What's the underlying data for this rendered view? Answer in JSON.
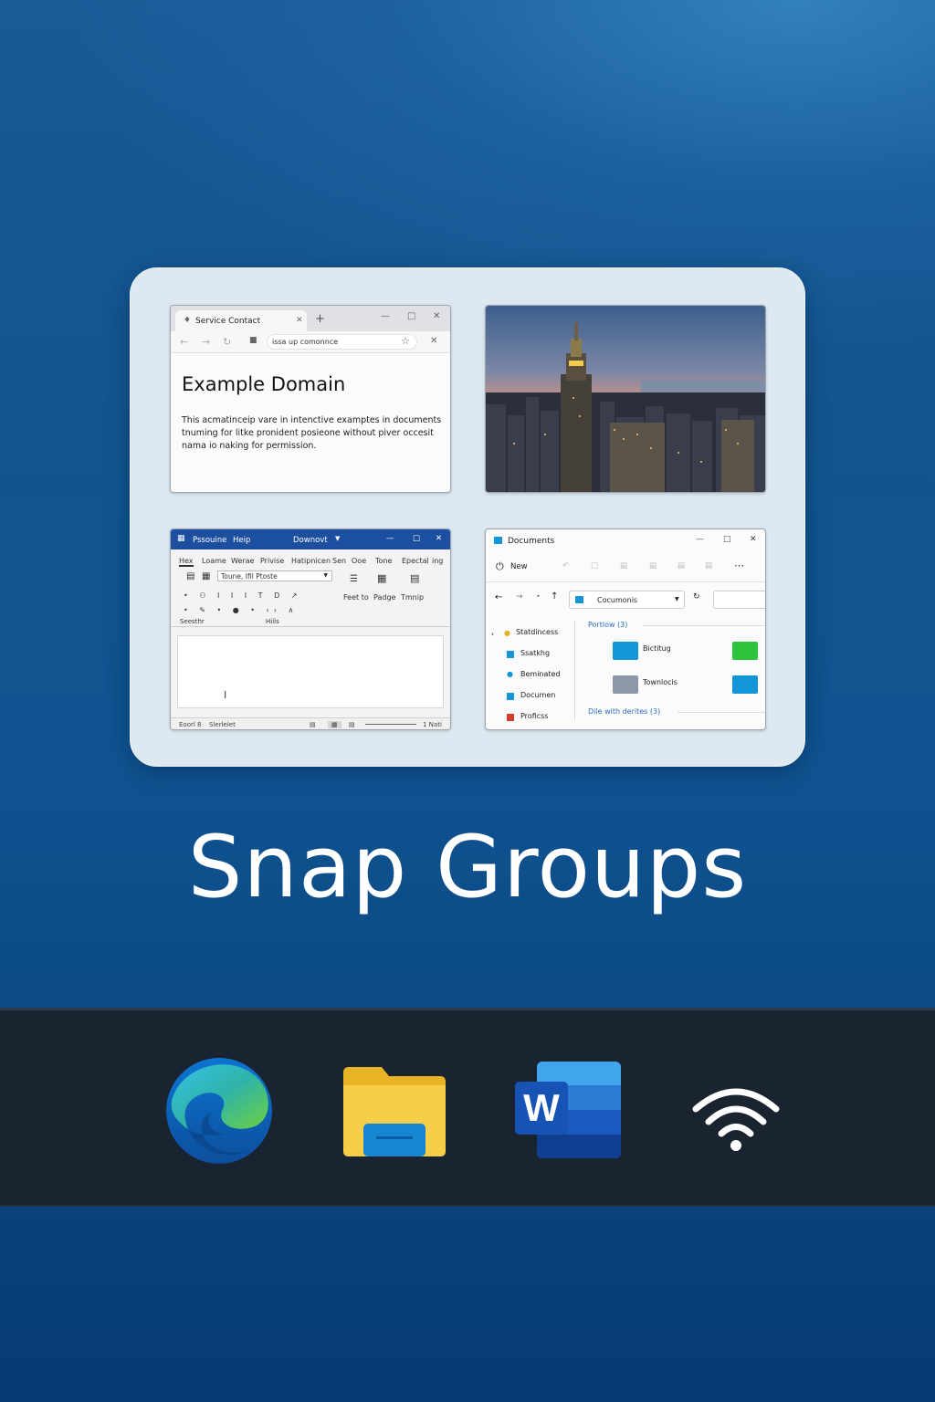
{
  "title": "Snap Groups",
  "browser": {
    "tab_title": "Service Contact",
    "new_tab": "+",
    "url": "issa up comonnce",
    "page_heading": "Example Domain",
    "page_text": "This acmatinceip vare in intenctive examptes in documents tnuming for litke pronident posieone without piver occesit nama io naking for permission."
  },
  "word": {
    "title_left": "Pssouine",
    "title_help": "Heip",
    "title_doc": "Downovt",
    "menu": [
      "Hex",
      "Loame",
      "Werae",
      "Privise",
      "Hatipnicen",
      "Sen",
      "Ooe",
      "Tone",
      "Epectal",
      "ing"
    ],
    "font_box": "Toune, Ifil Ptoste",
    "ribbon_labels": [
      "Feet to",
      "Padge",
      "Tmnip"
    ],
    "section_left": "Seesthr",
    "section_mid": "Hiils",
    "status_left": "Eoorl 8",
    "status_left2": "Slerlelet",
    "status_right": "1 Nati"
  },
  "explorer": {
    "title": "Documents",
    "new_label": "New",
    "path": "Cocumonis",
    "sidebar": [
      "Statdincess",
      "Ssatkhg",
      "Beminated",
      "Documen",
      "Proficss"
    ],
    "group1": "Portlow (3)",
    "group2": "Dile with derites (3)",
    "items": [
      "Bictitug",
      "Townlocis"
    ]
  },
  "colors": {
    "background_top": "#1a5a97",
    "panel": "#dde8f1",
    "word_blue": "#1c4f9f",
    "taskbar": "#1a2430"
  },
  "taskbar": {
    "icons": [
      "edge-icon",
      "file-explorer-icon",
      "word-icon",
      "wifi-icon"
    ],
    "word_letter": "W"
  }
}
